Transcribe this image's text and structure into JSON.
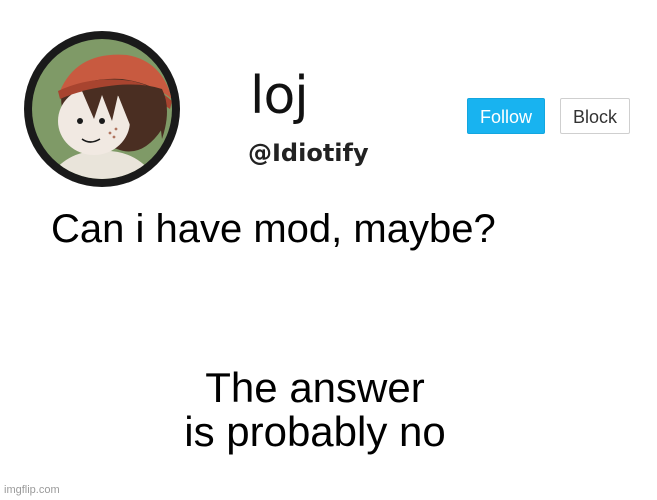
{
  "profile": {
    "display_name": "loj",
    "handle": "@Idiotify"
  },
  "actions": {
    "follow_label": "Follow",
    "block_label": "Block"
  },
  "post": {
    "line1": "Can i have mod, maybe?",
    "line2": "The answer\nis probably no"
  },
  "watermark": "imgflip.com",
  "colors": {
    "follow_button": "#18b3f0",
    "background": "#ffffff",
    "avatar_ring": "#1a1a1a",
    "avatar_bg": "#7f9a67",
    "hat": "#c85a40",
    "hair": "#4a2e22"
  },
  "icons": {
    "avatar": "profile-avatar-character"
  }
}
